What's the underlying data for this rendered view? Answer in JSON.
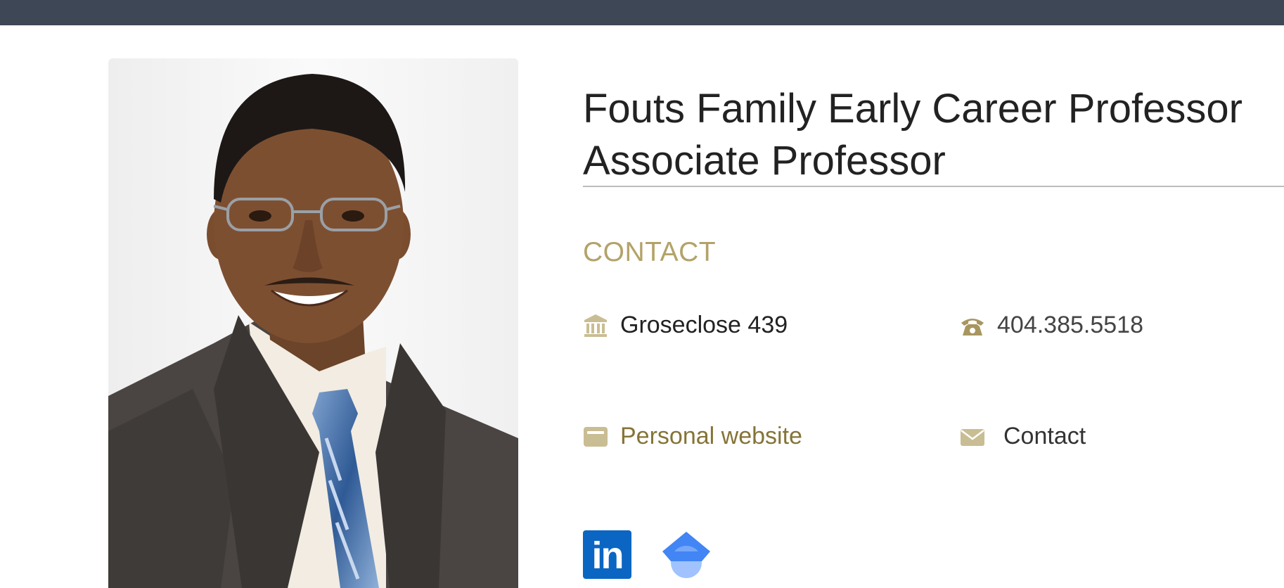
{
  "profile": {
    "photo_alt": "Portrait photo",
    "titles": [
      "Fouts Family Early Career Professor",
      "Associate Professor"
    ]
  },
  "contact": {
    "heading": "CONTACT",
    "office": {
      "icon": "building-icon",
      "text": "Groseclose 439"
    },
    "phone": {
      "icon": "phone-icon",
      "text": "404.385.5518"
    },
    "website": {
      "icon": "browser-window-icon",
      "text": "Personal website"
    },
    "email": {
      "icon": "envelope-icon",
      "text": "Contact"
    }
  },
  "social": {
    "linkedin": {
      "icon": "linkedin-icon",
      "text": "in"
    },
    "scholar": {
      "icon": "google-scholar-icon"
    }
  },
  "colors": {
    "topbar": "#3e4756",
    "accent_gold": "#b3a369",
    "link_gold": "#857437",
    "linkedin_blue": "#0a66c2",
    "scholar_blue": "#4285f4"
  }
}
